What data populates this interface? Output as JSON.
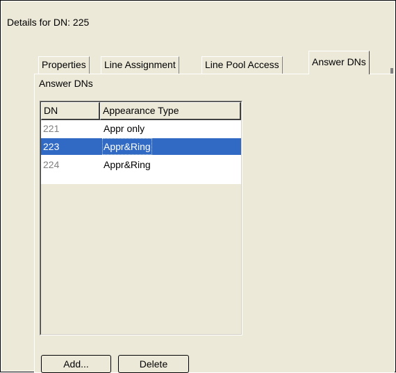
{
  "dialog": {
    "title": "Details for DN: 225"
  },
  "tabs": [
    {
      "label": "Properties",
      "active": false
    },
    {
      "label": "Line Assignment",
      "active": false
    },
    {
      "label": "Line Pool Access",
      "active": false
    },
    {
      "label": "Answer DNs",
      "active": true
    }
  ],
  "group": {
    "label": "Answer DNs"
  },
  "table": {
    "columns": [
      "DN",
      "Appearance Type"
    ],
    "rows": [
      {
        "dn": "221",
        "type": "Appr only",
        "selected": false
      },
      {
        "dn": "223",
        "type": "Appr&Ring",
        "selected": true
      },
      {
        "dn": "224",
        "type": "Appr&Ring",
        "selected": false
      }
    ]
  },
  "buttons": {
    "add": "Add...",
    "delete": "Delete"
  },
  "colors": {
    "selection": "#316ac5",
    "panel": "#ece9d8"
  }
}
